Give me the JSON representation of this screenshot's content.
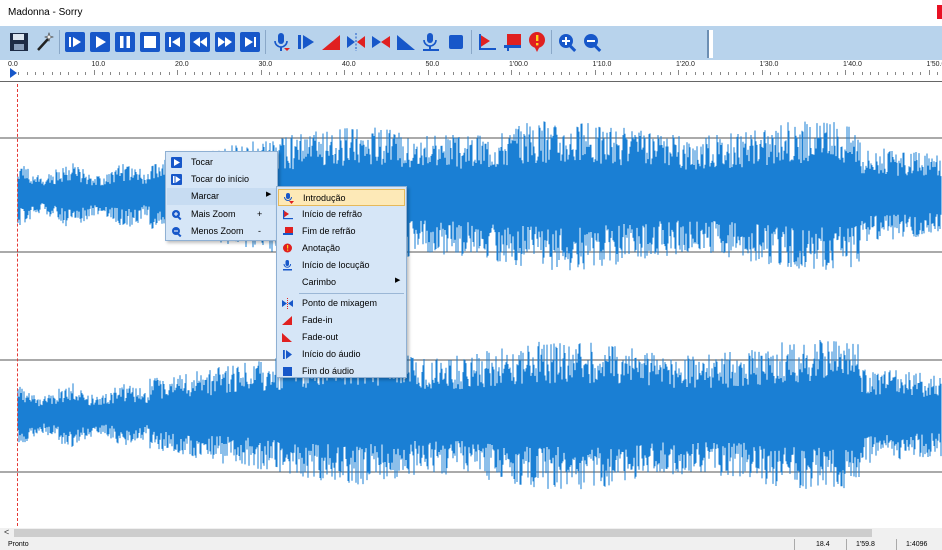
{
  "window": {
    "title": "Madonna - Sorry"
  },
  "toolbar": {
    "buttons": [
      {
        "name": "save-icon"
      },
      {
        "name": "magic-wand-icon"
      },
      {
        "name": "play-from-start-icon"
      },
      {
        "name": "play-icon"
      },
      {
        "name": "pause-icon"
      },
      {
        "name": "stop-icon"
      },
      {
        "name": "skip-back-icon"
      },
      {
        "name": "rewind-icon"
      },
      {
        "name": "fast-forward-icon"
      },
      {
        "name": "skip-forward-icon"
      },
      {
        "name": "microphone-icon"
      },
      {
        "name": "audio-start-icon"
      },
      {
        "name": "fade-in-icon"
      },
      {
        "name": "mix-point-icon"
      },
      {
        "name": "mix-point-end-icon"
      },
      {
        "name": "fade-out-icon"
      },
      {
        "name": "voice-start-icon"
      },
      {
        "name": "audio-end-icon"
      },
      {
        "name": "chorus-start-icon"
      },
      {
        "name": "chorus-end-icon"
      },
      {
        "name": "annotation-icon"
      },
      {
        "name": "zoom-in-icon"
      },
      {
        "name": "zoom-out-icon"
      }
    ]
  },
  "ruler": {
    "labels": [
      "0.0",
      "10.0",
      "20.0",
      "30.0",
      "40.0",
      "50.0",
      "1'00.0",
      "1'10.0",
      "1'20.0",
      "1'30.0",
      "1'40.0",
      "1'50.0"
    ]
  },
  "context_menu": {
    "items": [
      {
        "label": "Tocar",
        "icon": "play-icon"
      },
      {
        "label": "Tocar do início",
        "icon": "play-from-start-icon"
      },
      {
        "label": "Marcar",
        "icon": "",
        "submenu": true
      },
      {
        "label": "Mais Zoom",
        "shortcut": "+",
        "icon": "zoom-in-icon"
      },
      {
        "label": "Menos Zoom",
        "shortcut": "-",
        "icon": "zoom-out-icon"
      }
    ]
  },
  "submenu": {
    "items": [
      {
        "label": "Introdução",
        "icon": "intro-icon"
      },
      {
        "label": "Início de refrão",
        "icon": "chorus-start-icon"
      },
      {
        "label": "Fim de refrão",
        "icon": "chorus-end-icon"
      },
      {
        "label": "Anotação",
        "icon": "annotation-icon"
      },
      {
        "label": "Início de locução",
        "icon": "voice-start-icon"
      },
      {
        "label": "Carimbo",
        "icon": "",
        "submenu": true
      },
      {
        "label": "Ponto de mixagem",
        "icon": "mix-point-icon"
      },
      {
        "label": "Fade-in",
        "icon": "fade-in-icon"
      },
      {
        "label": "Fade-out",
        "icon": "fade-out-icon"
      },
      {
        "label": "Início do áudio",
        "icon": "audio-start-icon"
      },
      {
        "label": "Fim do áudio",
        "icon": "audio-end-icon"
      }
    ]
  },
  "scrollbar": {
    "left_arrow": "<"
  },
  "status": {
    "text": "Pronto",
    "values": [
      "18.4",
      "1'59.8",
      "1:4096"
    ]
  },
  "colors": {
    "toolbar_bg": "#b8d3ec",
    "wave": "#1a7fd4",
    "icon_blue": "#1757c9",
    "icon_red": "#e02020",
    "cursor": "#e53935"
  }
}
